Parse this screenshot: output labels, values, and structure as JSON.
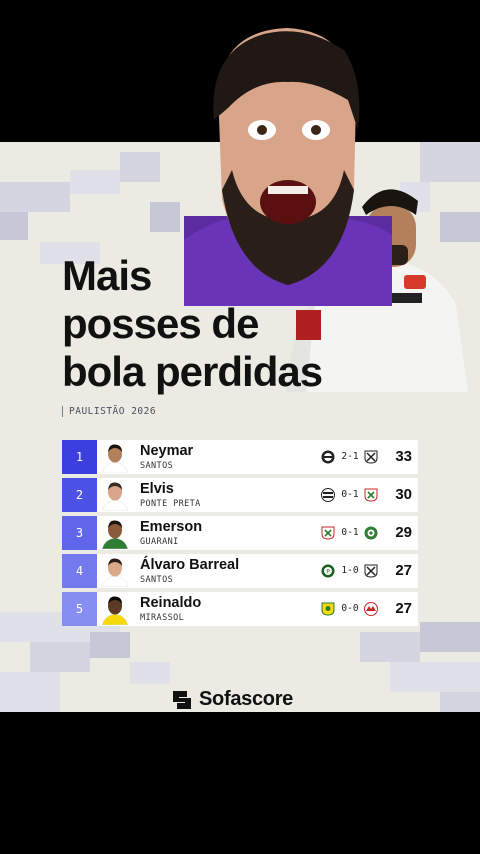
{
  "graphic": {
    "title_lines": [
      "Mais",
      "posses de",
      "bola perdidas"
    ],
    "subtitle": "PAULISTÃO 2026",
    "brand": "Sofascore"
  },
  "rows": [
    {
      "rank": "1",
      "name": "Neymar",
      "club": "SANTOS",
      "score": "2-1",
      "value": "33",
      "rank_color": "#3b3fe0",
      "home_crest": "corinthians-crest-icon",
      "away_crest": "santos-crest-icon"
    },
    {
      "rank": "2",
      "name": "Elvis",
      "club": "PONTE PRETA",
      "score": "0-1",
      "value": "30",
      "rank_color": "#4d52e6",
      "home_crest": "ponte-preta-crest-icon",
      "away_crest": "portuguesa-crest-icon"
    },
    {
      "rank": "3",
      "name": "Emerson",
      "club": "GUARANI",
      "score": "0-1",
      "value": "29",
      "rank_color": "#5f66ea",
      "home_crest": "portuguesa-crest-icon",
      "away_crest": "guarani-crest-icon"
    },
    {
      "rank": "4",
      "name": "Álvaro Barreal",
      "club": "SANTOS",
      "score": "1-0",
      "value": "27",
      "rank_color": "#737aee",
      "home_crest": "palmeiras-crest-icon",
      "away_crest": "santos-crest-icon"
    },
    {
      "rank": "5",
      "name": "Reinaldo",
      "club": "MIRASSOL",
      "score": "0-0",
      "value": "27",
      "rank_color": "#878ef2",
      "home_crest": "mirassol-crest-icon",
      "away_crest": "bragantino-crest-icon"
    }
  ]
}
